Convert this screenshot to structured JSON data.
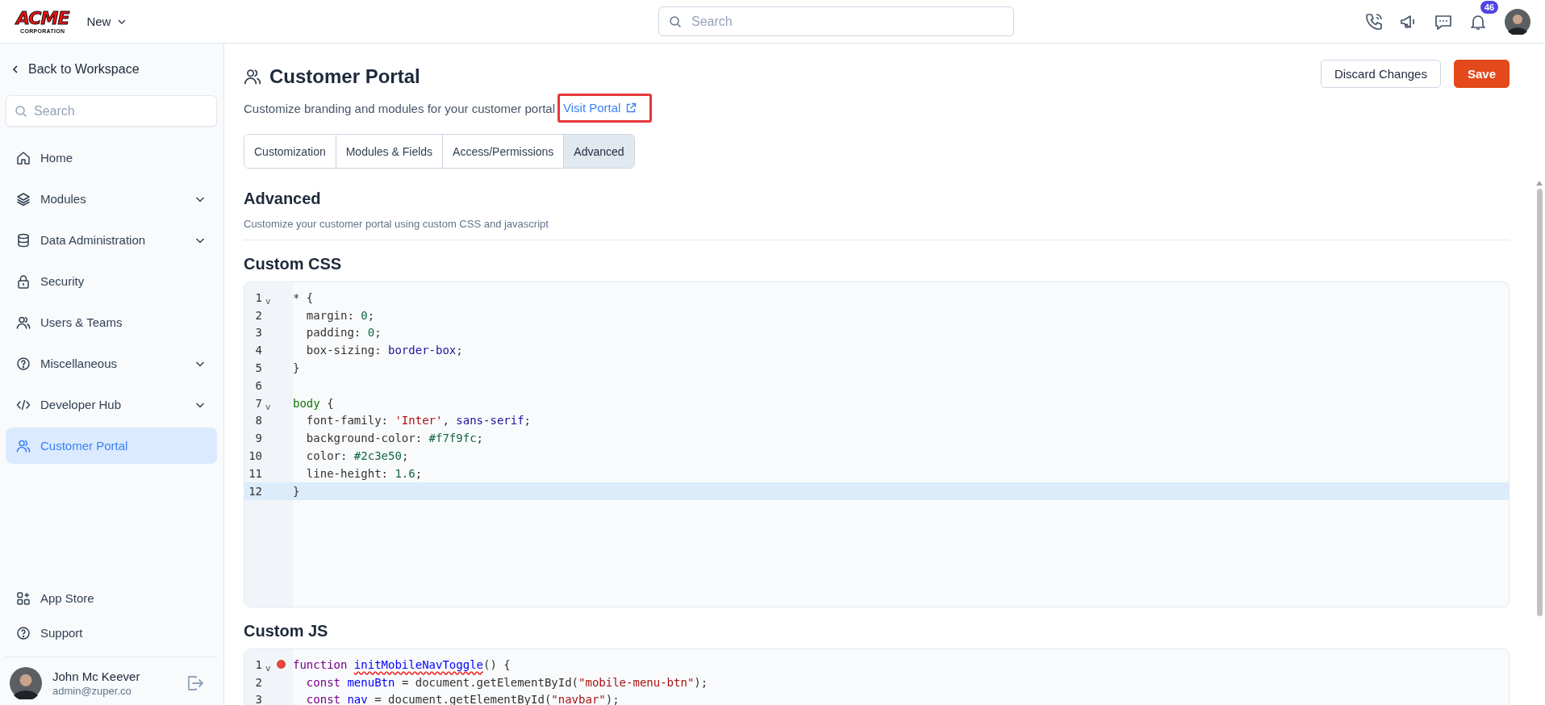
{
  "header": {
    "logo": {
      "line1": "ACME",
      "line2": "CORPORATION"
    },
    "new_menu": "New",
    "search": {
      "placeholder": "Search"
    },
    "notifications_badge": "46"
  },
  "sidebar": {
    "back_link": "Back to Workspace",
    "search": {
      "placeholder": "Search"
    },
    "items": [
      {
        "label": "Home",
        "expandable": false,
        "selected": false
      },
      {
        "label": "Modules",
        "expandable": true,
        "selected": false
      },
      {
        "label": "Data Administration",
        "expandable": true,
        "selected": false
      },
      {
        "label": "Security",
        "expandable": false,
        "selected": false
      },
      {
        "label": "Users & Teams",
        "expandable": false,
        "selected": false
      },
      {
        "label": "Miscellaneous",
        "expandable": true,
        "selected": false
      },
      {
        "label": "Developer Hub",
        "expandable": true,
        "selected": false
      },
      {
        "label": "Customer Portal",
        "expandable": false,
        "selected": true
      }
    ],
    "bottom_items": [
      {
        "label": "App Store"
      },
      {
        "label": "Support"
      }
    ],
    "user": {
      "name": "John Mc Keever",
      "email": "admin@zuper.co"
    }
  },
  "page": {
    "title": "Customer Portal",
    "subtitle": "Customize branding and modules for your customer portal",
    "link": {
      "label": "Visit Portal",
      "highlighted": true
    },
    "buttons": [
      {
        "label": "Discard Changes",
        "kind": "secondary"
      },
      {
        "label": "Save",
        "kind": "primary"
      }
    ],
    "tabs": [
      {
        "label": "Customization",
        "selected": false
      },
      {
        "label": "Modules & Fields",
        "selected": false
      },
      {
        "label": "Access/Permissions",
        "selected": false
      },
      {
        "label": "Advanced",
        "selected": true
      }
    ],
    "section": {
      "title": "Advanced",
      "description": "Customize your customer portal using custom CSS and javascript"
    },
    "editors": [
      {
        "title": "Custom CSS",
        "lines": [
          {
            "number": "1",
            "fold": "v",
            "breakpoint": false,
            "active": false,
            "tokens": [
              {
                "t": "* {",
                "kind": "plain"
              }
            ]
          },
          {
            "number": "2",
            "breakpoint": false,
            "active": false,
            "tokens": [
              {
                "t": "  margin: ",
                "kind": "plain"
              },
              {
                "t": "0",
                "kind": "number"
              },
              {
                "t": ";",
                "kind": "plain"
              }
            ]
          },
          {
            "number": "3",
            "breakpoint": false,
            "active": false,
            "tokens": [
              {
                "t": "  padding: ",
                "kind": "plain"
              },
              {
                "t": "0",
                "kind": "number"
              },
              {
                "t": ";",
                "kind": "plain"
              }
            ]
          },
          {
            "number": "4",
            "breakpoint": false,
            "active": false,
            "tokens": [
              {
                "t": "  box-sizing: ",
                "kind": "plain"
              },
              {
                "t": "border-box",
                "kind": "atom"
              },
              {
                "t": ";",
                "kind": "plain"
              }
            ]
          },
          {
            "number": "5",
            "breakpoint": false,
            "active": false,
            "tokens": [
              {
                "t": "}",
                "kind": "plain"
              }
            ]
          },
          {
            "number": "6",
            "breakpoint": false,
            "active": false
          },
          {
            "number": "7",
            "fold": "v",
            "breakpoint": false,
            "active": false,
            "tokens": [
              {
                "t": "body",
                "kind": "tag"
              },
              {
                "t": " {",
                "kind": "plain"
              }
            ]
          },
          {
            "number": "8",
            "breakpoint": false,
            "active": false,
            "tokens": [
              {
                "t": "  font-family: ",
                "kind": "plain"
              },
              {
                "t": "'Inter'",
                "kind": "string"
              },
              {
                "t": ", ",
                "kind": "plain"
              },
              {
                "t": "sans-serif",
                "kind": "atom"
              },
              {
                "t": ";",
                "kind": "plain"
              }
            ]
          },
          {
            "number": "9",
            "breakpoint": false,
            "active": false,
            "tokens": [
              {
                "t": "  background-color: ",
                "kind": "plain"
              },
              {
                "t": "#f7f9fc",
                "kind": "number"
              },
              {
                "t": ";",
                "kind": "plain"
              }
            ]
          },
          {
            "number": "10",
            "breakpoint": false,
            "active": false,
            "tokens": [
              {
                "t": "  color: ",
                "kind": "plain"
              },
              {
                "t": "#2c3e50",
                "kind": "number"
              },
              {
                "t": ";",
                "kind": "plain"
              }
            ]
          },
          {
            "number": "11",
            "breakpoint": false,
            "active": false,
            "tokens": [
              {
                "t": "  line-height: ",
                "kind": "plain"
              },
              {
                "t": "1.6",
                "kind": "number"
              },
              {
                "t": ";",
                "kind": "plain"
              }
            ]
          },
          {
            "number": "12",
            "breakpoint": false,
            "active": true,
            "tokens": [
              {
                "t": "}",
                "kind": "plain"
              }
            ]
          }
        ]
      },
      {
        "title": "Custom JS",
        "lines": [
          {
            "number": "1",
            "fold": "v",
            "breakpoint": true,
            "active": false,
            "tokens": [
              {
                "t": "function ",
                "kind": "keyword"
              },
              {
                "t": "initMobileNavToggle",
                "kind": "error-def"
              },
              {
                "t": "() {",
                "kind": "plain"
              }
            ]
          },
          {
            "number": "2",
            "breakpoint": false,
            "active": false,
            "tokens": [
              {
                "t": "  const",
                "kind": "keyword"
              },
              {
                "t": " menuBtn",
                "kind": "def"
              },
              {
                "t": " = document.getElementById(",
                "kind": "plain"
              },
              {
                "t": "\"mobile-menu-btn\"",
                "kind": "string"
              },
              {
                "t": ");",
                "kind": "plain"
              }
            ]
          },
          {
            "number": "3",
            "breakpoint": false,
            "active": false,
            "tokens": [
              {
                "t": "  const",
                "kind": "keyword"
              },
              {
                "t": " nav",
                "kind": "def"
              },
              {
                "t": " = document.getElementById(",
                "kind": "plain"
              },
              {
                "t": "\"navbar\"",
                "kind": "string"
              },
              {
                "t": ");",
                "kind": "plain"
              }
            ]
          }
        ]
      }
    ]
  }
}
